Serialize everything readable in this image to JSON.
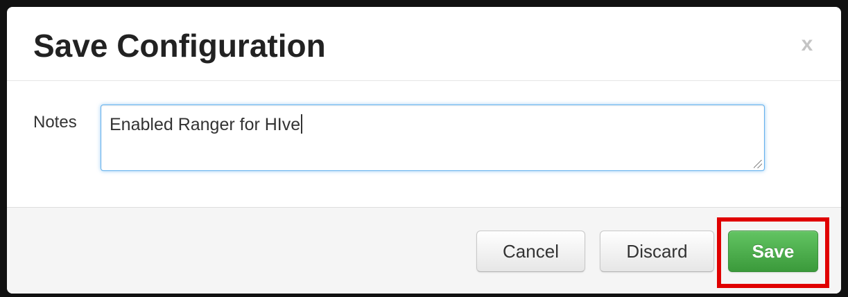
{
  "dialog": {
    "title": "Save Configuration",
    "close_label": "x"
  },
  "notes": {
    "label": "Notes",
    "value": "Enabled Ranger for HIve"
  },
  "footer": {
    "cancel_label": "Cancel",
    "discard_label": "Discard",
    "save_label": "Save"
  },
  "colors": {
    "save_button": "#4cae4c",
    "highlight": "#e00000",
    "focus_border": "#52a8ec"
  }
}
